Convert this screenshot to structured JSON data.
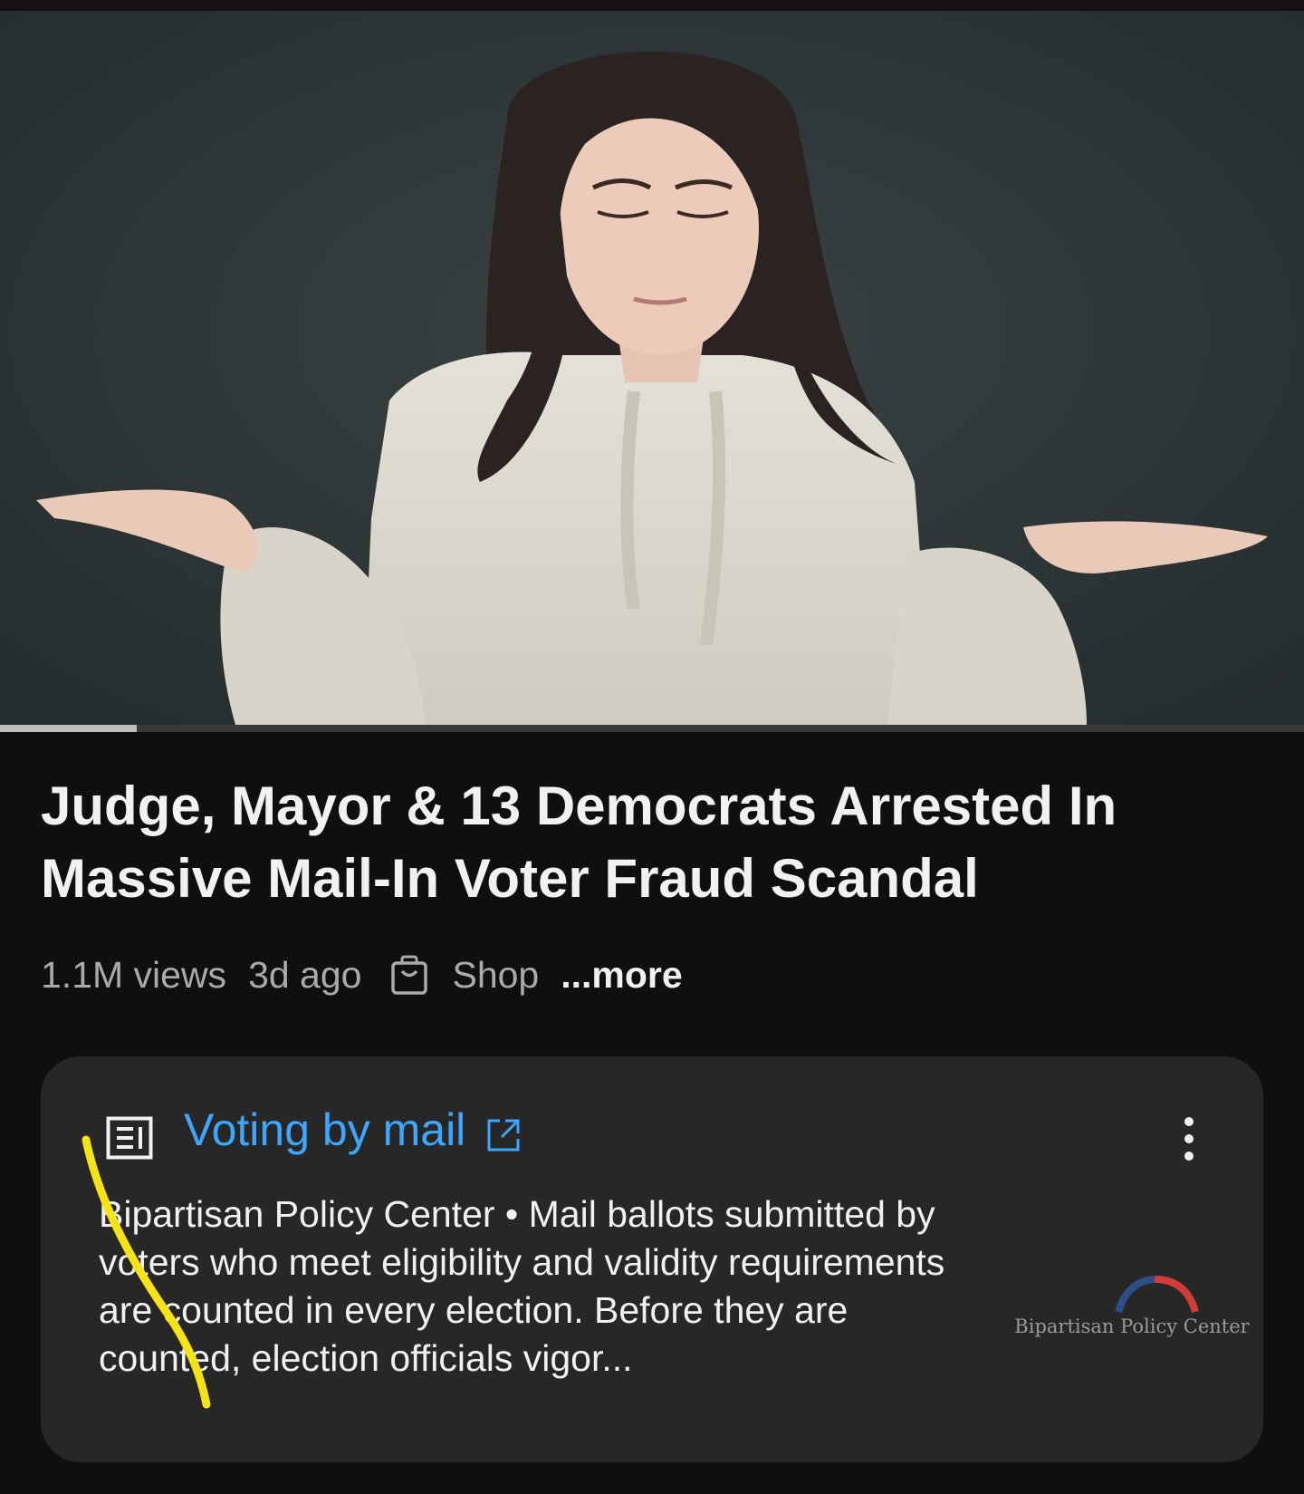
{
  "video": {
    "progress_fraction": 0.105
  },
  "title": "Judge, Mayor & 13 Democrats Arrested In Massive Mail-In Voter Fraud Scandal",
  "meta": {
    "views": "1.1M views",
    "age": "3d ago",
    "shop_icon": "shopping-bag-icon",
    "shop_label": "Shop",
    "more_label": "...more"
  },
  "info_panel": {
    "icon": "article-icon",
    "title": "Voting by mail",
    "link_icon": "external-link-icon",
    "menu_icon": "more-vert-icon",
    "source": "Bipartisan Policy Center",
    "separator": " • ",
    "text": "Mail ballots submitted by voters who meet eligibility and validity requirements are counted in every election. Before they are counted, election officials vigor...",
    "logo_text": "Bipartisan Policy Center",
    "logo_colors": {
      "blue": "#2d4f86",
      "red": "#d33a3a"
    }
  },
  "colors": {
    "background": "#0f0f0f",
    "card": "#272727",
    "link": "#3ea6ff",
    "annotation": "#f5e317"
  }
}
